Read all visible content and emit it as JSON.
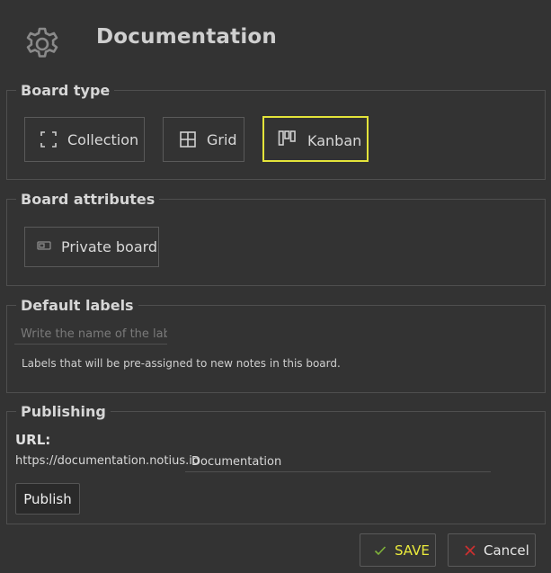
{
  "header": {
    "title": "Documentation",
    "icon": "gear-icon"
  },
  "board_type": {
    "legend": "Board type",
    "options": [
      {
        "label": "Collection",
        "icon": "collection-icon",
        "selected": false
      },
      {
        "label": "Grid",
        "icon": "grid-icon",
        "selected": false
      },
      {
        "label": "Kanban",
        "icon": "kanban-icon",
        "selected": true
      }
    ],
    "selected_color": "#e4e43a"
  },
  "board_attributes": {
    "legend": "Board attributes",
    "private_label": "Private board",
    "private_icon": "toggle-icon"
  },
  "default_labels": {
    "legend": "Default labels",
    "placeholder": "Write the name of the label",
    "value": "",
    "help": "Labels that will be pre-assigned to new notes in this board."
  },
  "publishing": {
    "legend": "Publishing",
    "url_label": "URL:",
    "url_prefix": "https://documentation.notius.io",
    "url_value": "Documentation",
    "publish_label": "Publish"
  },
  "footer": {
    "save_label": "SAVE",
    "save_icon": "check-icon",
    "save_color": "#eaea3c",
    "cancel_label": "Cancel",
    "cancel_icon": "close-icon",
    "cancel_icon_color": "#d03030"
  }
}
